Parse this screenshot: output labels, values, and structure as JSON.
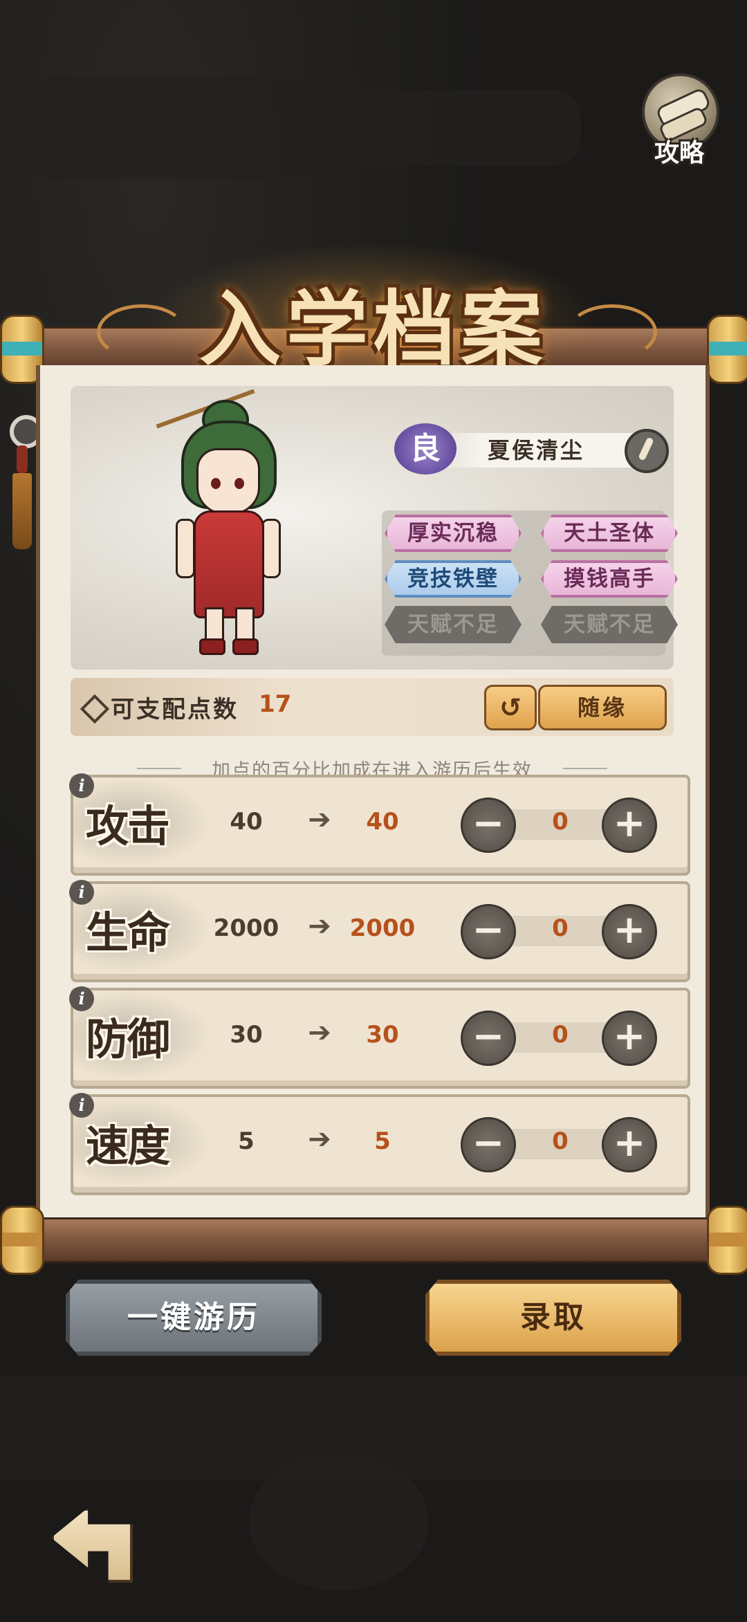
{
  "header": {
    "guide_label": "攻略",
    "title": "入学档案"
  },
  "student": {
    "rank": "良",
    "name": "夏侯清尘",
    "traits": [
      {
        "label": "厚实沉稳",
        "style": "purple"
      },
      {
        "label": "天土圣体",
        "style": "purple"
      },
      {
        "label": "竞技铁壁",
        "style": "blue"
      },
      {
        "label": "摸钱高手",
        "style": "purple"
      },
      {
        "label": "天赋不足",
        "style": "gray"
      },
      {
        "label": "天赋不足",
        "style": "gray"
      }
    ]
  },
  "points": {
    "label": "可支配点数",
    "value": "17",
    "reset_icon": "undo-icon",
    "random_label": "随缘"
  },
  "hint": "加点的百分比加成在进入游历后生效",
  "stats": [
    {
      "name": "攻击",
      "base": "40",
      "new": "40",
      "added": "0"
    },
    {
      "name": "生命",
      "base": "2000",
      "new": "2000",
      "added": "0"
    },
    {
      "name": "防御",
      "base": "30",
      "new": "30",
      "added": "0"
    },
    {
      "name": "速度",
      "base": "5",
      "new": "5",
      "added": "0"
    }
  ],
  "stepper": {
    "minus": "−",
    "plus": "+",
    "arrow": "➔",
    "info": "i"
  },
  "actions": {
    "travel_label": "一键游历",
    "admit_label": "录取"
  },
  "colors": {
    "accent_orange": "#b6511c",
    "trait_purple": "#e7b4d6",
    "trait_blue": "#a9c9ea",
    "button_gold": "#e8b665",
    "button_gray": "#7d8489"
  }
}
